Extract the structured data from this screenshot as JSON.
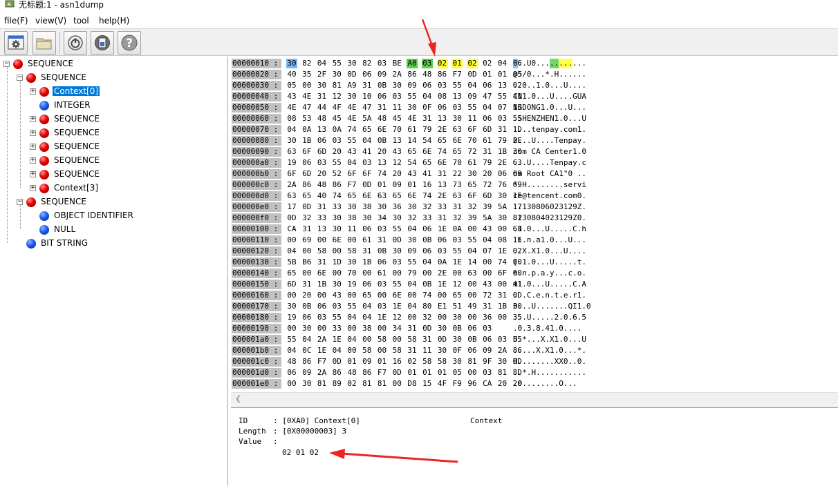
{
  "window": {
    "title": "无标题:1 - asn1dump"
  },
  "menu": [
    {
      "label": "file(F)"
    },
    {
      "label": "view(V)"
    },
    {
      "label": "tool"
    },
    {
      "label": "help(H)"
    }
  ],
  "toolbar": {
    "buttons": [
      {
        "icon": "settings-window-icon"
      },
      {
        "icon": "folder-icon"
      },
      {
        "icon": "power-icon"
      },
      {
        "icon": "disk-icon"
      },
      {
        "icon": "help-icon"
      }
    ]
  },
  "tree": {
    "nodes": [
      {
        "label": "SEQUENCE",
        "color": "red",
        "expander": "−"
      },
      {
        "label": "SEQUENCE",
        "color": "red",
        "expander": "−"
      },
      {
        "label": "Context[0]",
        "color": "red",
        "expander": "+",
        "selected": true
      },
      {
        "label": "INTEGER",
        "color": "blue",
        "expander": ""
      },
      {
        "label": "SEQUENCE",
        "color": "red",
        "expander": "+"
      },
      {
        "label": "SEQUENCE",
        "color": "red",
        "expander": "+"
      },
      {
        "label": "SEQUENCE",
        "color": "red",
        "expander": "+"
      },
      {
        "label": "SEQUENCE",
        "color": "red",
        "expander": "+"
      },
      {
        "label": "SEQUENCE",
        "color": "red",
        "expander": "+"
      },
      {
        "label": "Context[3]",
        "color": "red",
        "expander": "+"
      },
      {
        "label": "SEQUENCE",
        "color": "red",
        "expander": "−"
      },
      {
        "label": "OBJECT IDENTIFIER",
        "color": "blue",
        "expander": ""
      },
      {
        "label": "NULL",
        "color": "blue",
        "expander": ""
      },
      {
        "label": "BIT STRING",
        "color": "blue",
        "expander": ""
      }
    ]
  },
  "hex": {
    "rows": [
      {
        "addr": "00000010 :",
        "bytes": [
          "30",
          "82",
          "04",
          "55",
          "30",
          "82",
          "03",
          "BE",
          "A0",
          "03",
          "02",
          "01",
          "02",
          "02",
          "04",
          "06"
        ],
        "ascii": "0..U0..........."
      },
      {
        "addr": "00000020 :",
        "bytes": [
          "40",
          "35",
          "2F",
          "30",
          "0D",
          "06",
          "09",
          "2A",
          "86",
          "48",
          "86",
          "F7",
          "0D",
          "01",
          "01",
          "05"
        ],
        "ascii": "@5/0...*.H......"
      },
      {
        "addr": "00000030 :",
        "bytes": [
          "05",
          "00",
          "30",
          "81",
          "A9",
          "31",
          "0B",
          "30",
          "09",
          "06",
          "03",
          "55",
          "04",
          "06",
          "13",
          "02"
        ],
        "ascii": "..0..1.0...U...."
      },
      {
        "addr": "00000040 :",
        "bytes": [
          "43",
          "4E",
          "31",
          "12",
          "30",
          "10",
          "06",
          "03",
          "55",
          "04",
          "08",
          "13",
          "09",
          "47",
          "55",
          "41"
        ],
        "ascii": "CN1.0...U....GUA"
      },
      {
        "addr": "00000050 :",
        "bytes": [
          "4E",
          "47",
          "44",
          "4F",
          "4E",
          "47",
          "31",
          "11",
          "30",
          "0F",
          "06",
          "03",
          "55",
          "04",
          "07",
          "13"
        ],
        "ascii": "NGDONG1.0...U..."
      },
      {
        "addr": "00000060 :",
        "bytes": [
          "08",
          "53",
          "48",
          "45",
          "4E",
          "5A",
          "48",
          "45",
          "4E",
          "31",
          "13",
          "30",
          "11",
          "06",
          "03",
          "55"
        ],
        "ascii": ".SHENZHEN1.0...U"
      },
      {
        "addr": "00000070 :",
        "bytes": [
          "04",
          "0A",
          "13",
          "0A",
          "74",
          "65",
          "6E",
          "70",
          "61",
          "79",
          "2E",
          "63",
          "6F",
          "6D",
          "31",
          "1D"
        ],
        "ascii": "....tenpay.com1."
      },
      {
        "addr": "00000080 :",
        "bytes": [
          "30",
          "1B",
          "06",
          "03",
          "55",
          "04",
          "0B",
          "13",
          "14",
          "54",
          "65",
          "6E",
          "70",
          "61",
          "79",
          "2E"
        ],
        "ascii": "0...U....Tenpay."
      },
      {
        "addr": "00000090 :",
        "bytes": [
          "63",
          "6F",
          "6D",
          "20",
          "43",
          "41",
          "20",
          "43",
          "65",
          "6E",
          "74",
          "65",
          "72",
          "31",
          "1B",
          "30"
        ],
        "ascii": "com CA Center1.0"
      },
      {
        "addr": "000000a0 :",
        "bytes": [
          "19",
          "06",
          "03",
          "55",
          "04",
          "03",
          "13",
          "12",
          "54",
          "65",
          "6E",
          "70",
          "61",
          "79",
          "2E",
          "63"
        ],
        "ascii": "...U....Tenpay.c"
      },
      {
        "addr": "000000b0 :",
        "bytes": [
          "6F",
          "6D",
          "20",
          "52",
          "6F",
          "6F",
          "74",
          "20",
          "43",
          "41",
          "31",
          "22",
          "30",
          "20",
          "06",
          "09"
        ],
        "ascii": "om Root CA1\"0 .."
      },
      {
        "addr": "000000c0 :",
        "bytes": [
          "2A",
          "86",
          "48",
          "86",
          "F7",
          "0D",
          "01",
          "09",
          "01",
          "16",
          "13",
          "73",
          "65",
          "72",
          "76",
          "69"
        ],
        "ascii": "*.H........servi"
      },
      {
        "addr": "000000d0 :",
        "bytes": [
          "63",
          "65",
          "40",
          "74",
          "65",
          "6E",
          "63",
          "65",
          "6E",
          "74",
          "2E",
          "63",
          "6F",
          "6D",
          "30",
          "1E"
        ],
        "ascii": "ce@tencent.com0."
      },
      {
        "addr": "000000e0 :",
        "bytes": [
          "17",
          "0D",
          "31",
          "33",
          "30",
          "38",
          "30",
          "36",
          "30",
          "32",
          "33",
          "31",
          "32",
          "39",
          "5A",
          "17"
        ],
        "ascii": "..130806023129Z."
      },
      {
        "addr": "000000f0 :",
        "bytes": [
          "0D",
          "32",
          "33",
          "30",
          "38",
          "30",
          "34",
          "30",
          "32",
          "33",
          "31",
          "32",
          "39",
          "5A",
          "30",
          "81"
        ],
        "ascii": ".230804023129Z0."
      },
      {
        "addr": "00000100 :",
        "bytes": [
          "CA",
          "31",
          "13",
          "30",
          "11",
          "06",
          "03",
          "55",
          "04",
          "06",
          "1E",
          "0A",
          "00",
          "43",
          "00",
          "68"
        ],
        "ascii": ".1.0...U.....C.h"
      },
      {
        "addr": "00000110 :",
        "bytes": [
          "00",
          "69",
          "00",
          "6E",
          "00",
          "61",
          "31",
          "0D",
          "30",
          "0B",
          "06",
          "03",
          "55",
          "04",
          "08",
          "1E"
        ],
        "ascii": ".i.n.a1.0...U..."
      },
      {
        "addr": "00000120 :",
        "bytes": [
          "04",
          "00",
          "58",
          "00",
          "58",
          "31",
          "0B",
          "30",
          "09",
          "06",
          "03",
          "55",
          "04",
          "07",
          "1E",
          "02"
        ],
        "ascii": "..X.X1.0...U...."
      },
      {
        "addr": "00000130 :",
        "bytes": [
          "5B",
          "B6",
          "31",
          "1D",
          "30",
          "1B",
          "06",
          "03",
          "55",
          "04",
          "0A",
          "1E",
          "14",
          "00",
          "74",
          "00"
        ],
        "ascii": "[.1.0...U.....t."
      },
      {
        "addr": "00000140 :",
        "bytes": [
          "65",
          "00",
          "6E",
          "00",
          "70",
          "00",
          "61",
          "00",
          "79",
          "00",
          "2E",
          "00",
          "63",
          "00",
          "6F",
          "00"
        ],
        "ascii": "e.n.p.a.y...c.o."
      },
      {
        "addr": "00000150 :",
        "bytes": [
          "6D",
          "31",
          "1B",
          "30",
          "19",
          "06",
          "03",
          "55",
          "04",
          "0B",
          "1E",
          "12",
          "00",
          "43",
          "00",
          "41"
        ],
        "ascii": "m1.0...U.....C.A"
      },
      {
        "addr": "00000160 :",
        "bytes": [
          "00",
          "20",
          "00",
          "43",
          "00",
          "65",
          "00",
          "6E",
          "00",
          "74",
          "00",
          "65",
          "00",
          "72",
          "31",
          "0D"
        ],
        "ascii": ". .C.e.n.t.e.r1."
      },
      {
        "addr": "00000170 :",
        "bytes": [
          "30",
          "0B",
          "06",
          "03",
          "55",
          "04",
          "03",
          "1E",
          "04",
          "80",
          "E1",
          "51",
          "49",
          "31",
          "1B",
          "30"
        ],
        "ascii": "0...U.......QI1.0"
      },
      {
        "addr": "00000180 :",
        "bytes": [
          "19",
          "06",
          "03",
          "55",
          "04",
          "04",
          "1E",
          "12",
          "00",
          "32",
          "00",
          "30",
          "00",
          "36",
          "00",
          "35"
        ],
        "ascii": "...U.....2.0.6.5"
      },
      {
        "addr": "00000190 :",
        "bytes": [
          "00",
          "30",
          "00",
          "33",
          "00",
          "38",
          "00",
          "34",
          "31",
          "0D",
          "30",
          "0B",
          "06",
          "03"
        ],
        "ascii": ".0.3.8.41.0...."
      },
      {
        "addr": "000001a0 :",
        "bytes": [
          "55",
          "04",
          "2A",
          "1E",
          "04",
          "00",
          "58",
          "00",
          "58",
          "31",
          "0D",
          "30",
          "0B",
          "06",
          "03",
          "55"
        ],
        "ascii": "U.*...X.X1.0...U"
      },
      {
        "addr": "000001b0 :",
        "bytes": [
          "04",
          "0C",
          "1E",
          "04",
          "00",
          "58",
          "00",
          "58",
          "31",
          "11",
          "30",
          "0F",
          "06",
          "09",
          "2A",
          "86"
        ],
        "ascii": ".....X.X1.0...*."
      },
      {
        "addr": "000001c0 :",
        "bytes": [
          "48",
          "86",
          "F7",
          "0D",
          "01",
          "09",
          "01",
          "16",
          "02",
          "58",
          "58",
          "30",
          "81",
          "9F",
          "30",
          "0D"
        ],
        "ascii": "H........XX0..0."
      },
      {
        "addr": "000001d0 :",
        "bytes": [
          "06",
          "09",
          "2A",
          "86",
          "48",
          "86",
          "F7",
          "0D",
          "01",
          "01",
          "01",
          "05",
          "00",
          "03",
          "81",
          "8D"
        ],
        "ascii": "..*.H..........."
      },
      {
        "addr": "000001e0 :",
        "bytes": [
          "00",
          "30",
          "81",
          "89",
          "02",
          "81",
          "81",
          "00",
          "D8",
          "15",
          "4F",
          "F9",
          "96",
          "CA",
          "20",
          "20"
        ],
        "ascii": ".0........O..."
      }
    ],
    "highlight_colors": {
      "tag": "#7ab4f5",
      "length": "#5bd04c",
      "value": "#ffff33"
    }
  },
  "info": {
    "id_label": "ID",
    "id_value": ": [0XA0] Context[0]",
    "type_name": "Context",
    "length_label": "Length",
    "length_value": ": [0X00000003] 3",
    "value_label": "Value",
    "value_sep": ":",
    "value_bytes": "02 01 02"
  }
}
